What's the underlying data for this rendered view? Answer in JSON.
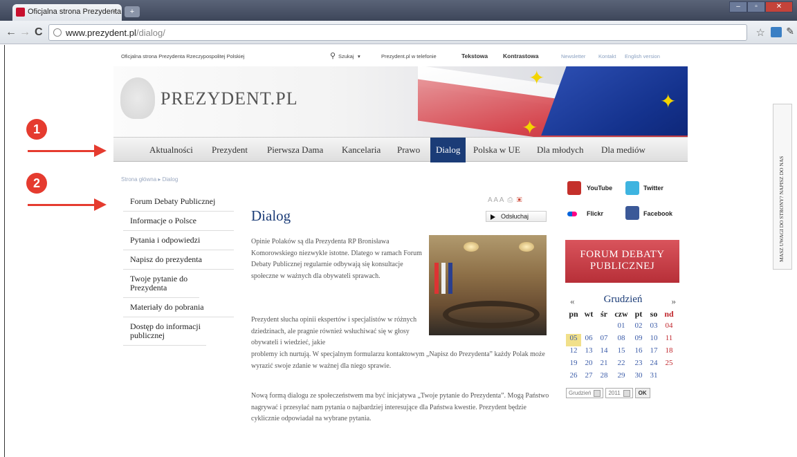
{
  "browser": {
    "tab_title": "Oficjalna strona Prezydenta",
    "tab_close": "×",
    "new_tab": "+",
    "url_host": "www.prezydent.pl",
    "url_path": "/dialog/",
    "back": "←",
    "forward": "→",
    "reload": "C",
    "star": "☆",
    "wrench": "✎",
    "min": "–",
    "max": "▫",
    "close": "✕"
  },
  "topbar": {
    "site_name": "Oficjalna strona Prezydenta Rzeczypospolitej Polskiej",
    "search": "Szukaj",
    "mobile": "Prezydent.pl w telefonie",
    "text_version": "Tekstowa",
    "contrast": "Kontrastowa",
    "newsletter": "Newsletter",
    "contact": "Kontakt",
    "english": "English version"
  },
  "banner": {
    "logo_text": "PREZYDENT.PL"
  },
  "nav": [
    "Aktualności",
    "Prezydent",
    "Pierwsza Dama",
    "Kancelaria",
    "Prawo",
    "Dialog",
    "Polska w UE",
    "Dla młodych",
    "Dla mediów"
  ],
  "annotations": {
    "badge1": "1",
    "badge2": "2"
  },
  "breadcrumb": "Strona główna ▸ Dialog",
  "left_menu": [
    "Forum Debaty Publicznej",
    "Informacje o Polsce",
    "Pytania i odpowiedzi",
    "Napisz do prezydenta",
    "Twoje pytanie do Prezydenta",
    "Materiały do pobrania",
    "Dostęp do informacji publicznej"
  ],
  "content": {
    "title": "Dialog",
    "font_sizes": "A A A",
    "listen": "Odsłuchaj",
    "p1": "Opinie Polaków są dla Prezydenta RP Bronisława Komorowskiego niezwykle istotne. Dlatego w ramach Forum Debaty Publicznej regularnie odbywają się konsultacje społeczne w ważnych dla obywateli sprawach.",
    "p2a": "Prezydent słucha opinii ekspertów i specjalistów w różnych dziedzinach, ale pragnie również wsłuchiwać się w głosy obywateli i wiedzieć, jakie",
    "p2b": "problemy ich nurtują. W specjalnym formularzu kontaktowym „Napisz do Prezydenta” każdy Polak może wyrazić swoje zdanie w ważnej dla niego sprawie.",
    "p3": "Nową formą dialogu ze społeczeństwem ma być inicjatywa „Twoje pytanie do Prezydenta”. Mogą Państwo nagrywać i przesyłać nam pytania o najbardziej interesujące dla Państwa kwestie. Prezydent będzie cyklicznie odpowiadał na wybrane pytania."
  },
  "social": {
    "youtube": "YouTube",
    "twitter": "Twitter",
    "flickr": "Flickr",
    "facebook": "Facebook"
  },
  "forum_banner": "FORUM DEBATY PUBLICZNEJ",
  "calendar": {
    "month": "Grudzień",
    "prev": "«",
    "next": "»",
    "weekdays": [
      "pn",
      "wt",
      "śr",
      "czw",
      "pt",
      "so",
      "nd"
    ],
    "weeks": [
      [
        "",
        "",
        "",
        "",
        "01",
        "02",
        "03",
        "04"
      ],
      [
        "05",
        "06",
        "07",
        "08",
        "09",
        "10",
        "11"
      ],
      [
        "12",
        "13",
        "14",
        "15",
        "16",
        "17",
        "18"
      ],
      [
        "19",
        "20",
        "21",
        "22",
        "23",
        "24",
        "25"
      ],
      [
        "26",
        "27",
        "28",
        "29",
        "30",
        "31",
        ""
      ]
    ],
    "today": "05",
    "month_select": "Grudzień",
    "year_select": "2011",
    "ok": "OK"
  },
  "feedback_tab": "MASZ UWAGI DO STRONY? NAPISZ DO NAS",
  "colors": {
    "nav_active": "#1b3c77",
    "annotation_red": "#e53b2f",
    "forum_red": "#c0353e"
  }
}
